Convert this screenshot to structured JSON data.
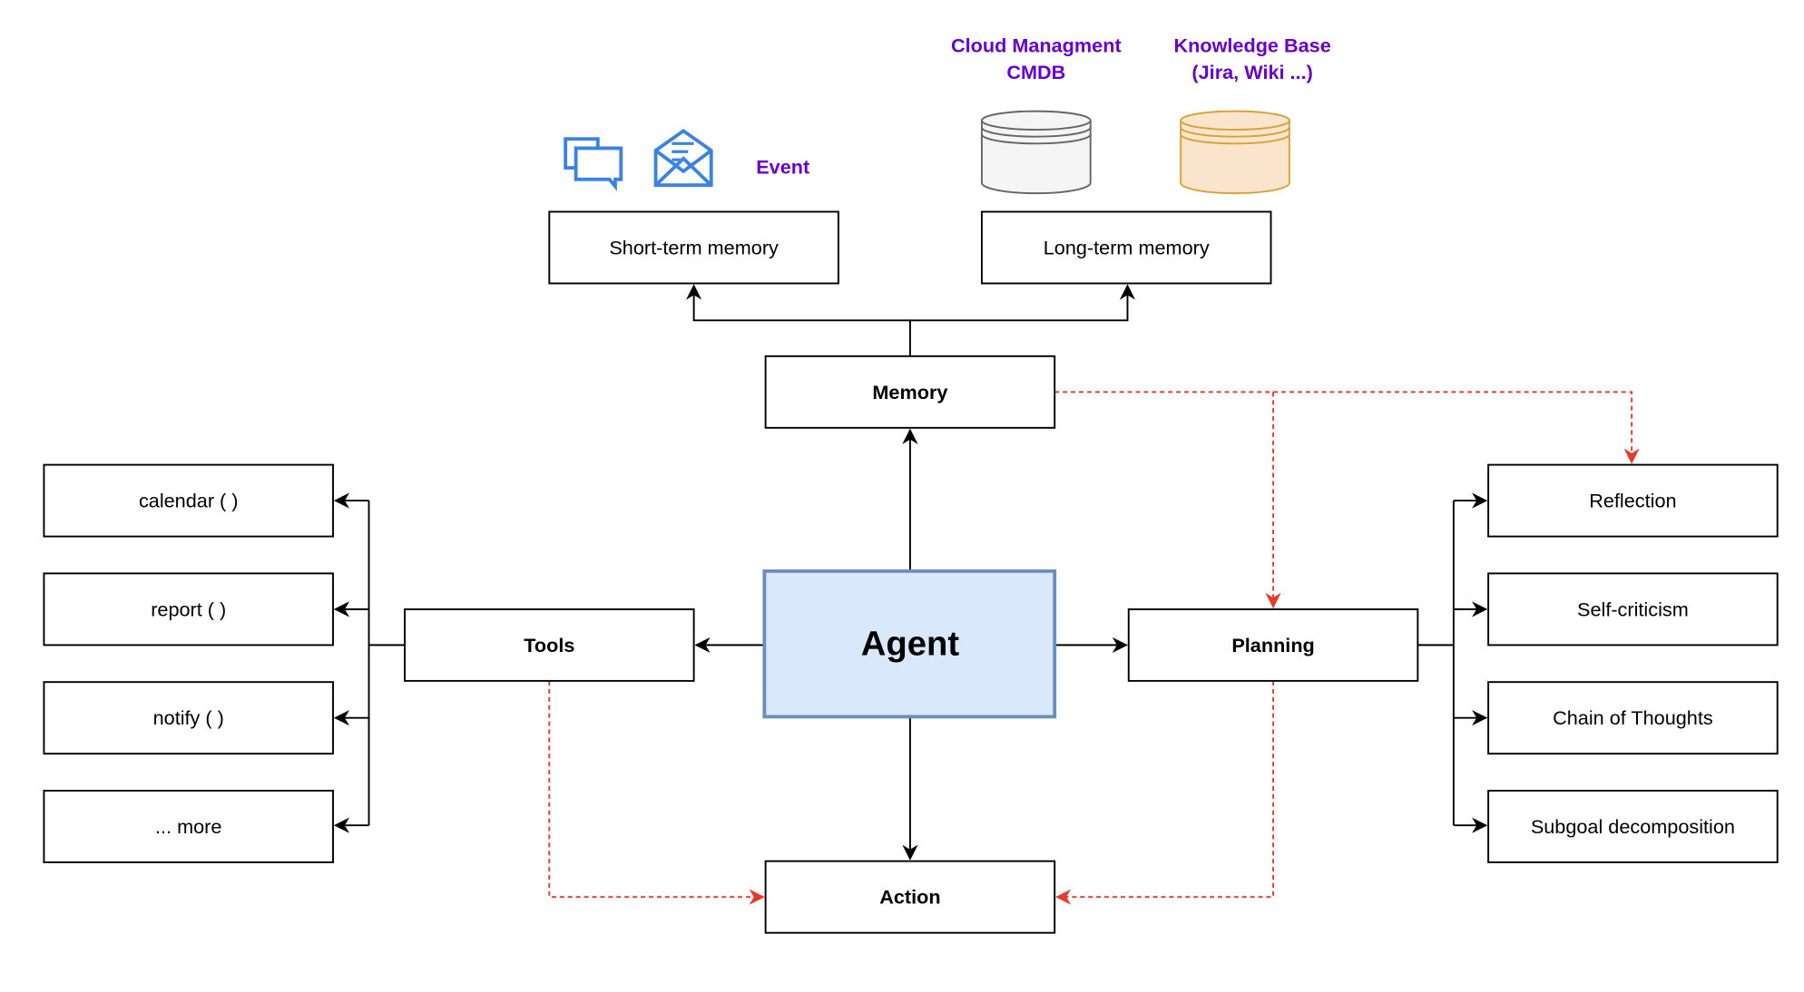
{
  "colors": {
    "agent_fill": "#dae8fc",
    "agent_stroke": "#6c8ebf",
    "dashed_edge": "#e8392f",
    "note_text": "#6600cc",
    "icon_blue": "#3b82e6",
    "cmdb_fill": "#f5f5f5",
    "kb_fill": "#fae5cc",
    "kb_stroke": "#d6a33a"
  },
  "nodes": {
    "agent": "Agent",
    "memory": "Memory",
    "tools": "Tools",
    "planning": "Planning",
    "action": "Action",
    "short_term": "Short-term memory",
    "long_term": "Long-term memory",
    "tools_list": [
      "calendar ( )",
      "report ( )",
      "notify ( )",
      "... more"
    ],
    "planning_list": [
      "Reflection",
      "Self-criticism",
      "Chain of Thoughts",
      "Subgoal decomposition"
    ]
  },
  "notes": {
    "event": "Event",
    "cmdb": [
      "Cloud Managment",
      "CMDB"
    ],
    "kb": [
      "Knowledge Base",
      "(Jira, Wiki ...)"
    ]
  },
  "icons": [
    "chat-icon",
    "email-icon",
    "database-icon"
  ]
}
